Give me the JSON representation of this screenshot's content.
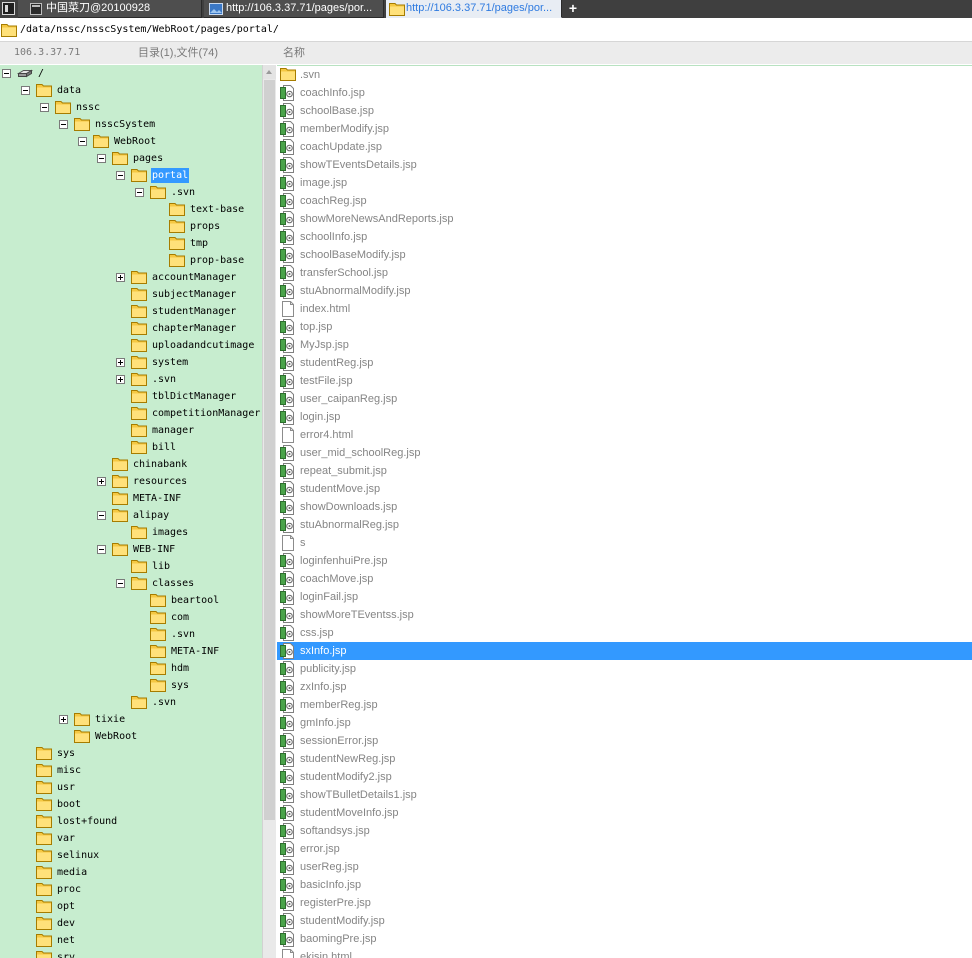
{
  "window": {
    "tabs": [
      {
        "label": "中国菜刀@20100928",
        "icon": "app-window-icon",
        "active": false
      },
      {
        "label": "http://106.3.37.71/pages/por...",
        "icon": "image-icon",
        "active": false
      },
      {
        "label": "http://106.3.37.71/pages/por...",
        "icon": "folder-icon",
        "active": true
      }
    ],
    "new_tab_label": "+"
  },
  "address_bar": {
    "icon": "folder-icon",
    "path": "/data/nssc/nsscSystem/WebRoot/pages/portal/"
  },
  "header": {
    "host": "106.3.37.71",
    "summary": "目录(1),文件(74)",
    "name_column": "名称"
  },
  "tree": {
    "items": [
      {
        "label": "/",
        "level": 0,
        "icon": "drive-icon",
        "expanded": true
      },
      {
        "label": "data",
        "level": 1,
        "icon": "folder-icon",
        "expanded": true
      },
      {
        "label": "nssc",
        "level": 2,
        "icon": "folder-icon",
        "expanded": true
      },
      {
        "label": "nsscSystem",
        "level": 3,
        "icon": "folder-icon",
        "expanded": true
      },
      {
        "label": "WebRoot",
        "level": 4,
        "icon": "folder-icon",
        "expanded": true
      },
      {
        "label": "pages",
        "level": 5,
        "icon": "folder-icon",
        "expanded": true
      },
      {
        "label": "portal",
        "level": 6,
        "icon": "folder-icon",
        "expanded": true,
        "selected": true
      },
      {
        "label": ".svn",
        "level": 7,
        "icon": "folder-icon",
        "expanded": true
      },
      {
        "label": "text-base",
        "level": 8,
        "icon": "folder-icon"
      },
      {
        "label": "props",
        "level": 8,
        "icon": "folder-icon"
      },
      {
        "label": "tmp",
        "level": 8,
        "icon": "folder-icon"
      },
      {
        "label": "prop-base",
        "level": 8,
        "icon": "folder-icon"
      },
      {
        "label": "accountManager",
        "level": 6,
        "icon": "folder-icon",
        "expanded": false
      },
      {
        "label": "subjectManager",
        "level": 6,
        "icon": "folder-icon"
      },
      {
        "label": "studentManager",
        "level": 6,
        "icon": "folder-icon"
      },
      {
        "label": "chapterManager",
        "level": 6,
        "icon": "folder-icon"
      },
      {
        "label": "uploadandcutimage",
        "level": 6,
        "icon": "folder-icon"
      },
      {
        "label": "system",
        "level": 6,
        "icon": "folder-icon",
        "expanded": false
      },
      {
        "label": ".svn",
        "level": 6,
        "icon": "folder-icon",
        "expanded": false
      },
      {
        "label": "tblDictManager",
        "level": 6,
        "icon": "folder-icon"
      },
      {
        "label": "competitionManager",
        "level": 6,
        "icon": "folder-icon"
      },
      {
        "label": "manager",
        "level": 6,
        "icon": "folder-icon"
      },
      {
        "label": "bill",
        "level": 6,
        "icon": "folder-icon"
      },
      {
        "label": "chinabank",
        "level": 5,
        "icon": "folder-icon"
      },
      {
        "label": "resources",
        "level": 5,
        "icon": "folder-icon",
        "expanded": false
      },
      {
        "label": "META-INF",
        "level": 5,
        "icon": "folder-icon"
      },
      {
        "label": "alipay",
        "level": 5,
        "icon": "folder-icon",
        "expanded": true
      },
      {
        "label": "images",
        "level": 6,
        "icon": "folder-icon"
      },
      {
        "label": "WEB-INF",
        "level": 5,
        "icon": "folder-icon",
        "expanded": true
      },
      {
        "label": "lib",
        "level": 6,
        "icon": "folder-icon"
      },
      {
        "label": "classes",
        "level": 6,
        "icon": "folder-icon",
        "expanded": true
      },
      {
        "label": "beartool",
        "level": 7,
        "icon": "folder-icon"
      },
      {
        "label": "com",
        "level": 7,
        "icon": "folder-icon"
      },
      {
        "label": ".svn",
        "level": 7,
        "icon": "folder-icon"
      },
      {
        "label": "META-INF",
        "level": 7,
        "icon": "folder-icon"
      },
      {
        "label": "hdm",
        "level": 7,
        "icon": "folder-icon"
      },
      {
        "label": "sys",
        "level": 7,
        "icon": "folder-icon"
      },
      {
        "label": ".svn",
        "level": 6,
        "icon": "folder-icon"
      },
      {
        "label": "tixie",
        "level": 3,
        "icon": "folder-icon",
        "expanded": false
      },
      {
        "label": "WebRoot",
        "level": 3,
        "icon": "folder-icon"
      },
      {
        "label": "sys",
        "level": 1,
        "icon": "folder-icon"
      },
      {
        "label": "misc",
        "level": 1,
        "icon": "folder-icon"
      },
      {
        "label": "usr",
        "level": 1,
        "icon": "folder-icon"
      },
      {
        "label": "boot",
        "level": 1,
        "icon": "folder-icon"
      },
      {
        "label": "lost+found",
        "level": 1,
        "icon": "folder-icon"
      },
      {
        "label": "var",
        "level": 1,
        "icon": "folder-icon"
      },
      {
        "label": "selinux",
        "level": 1,
        "icon": "folder-icon"
      },
      {
        "label": "media",
        "level": 1,
        "icon": "folder-icon"
      },
      {
        "label": "proc",
        "level": 1,
        "icon": "folder-icon"
      },
      {
        "label": "opt",
        "level": 1,
        "icon": "folder-icon"
      },
      {
        "label": "dev",
        "level": 1,
        "icon": "folder-icon"
      },
      {
        "label": "net",
        "level": 1,
        "icon": "folder-icon"
      },
      {
        "label": "srv",
        "level": 1,
        "icon": "folder-icon"
      }
    ]
  },
  "files": {
    "items": [
      {
        "name": ".svn",
        "icon": "folder-icon"
      },
      {
        "name": "coachInfo.jsp",
        "icon": "jsp-file-icon"
      },
      {
        "name": "schoolBase.jsp",
        "icon": "jsp-file-icon"
      },
      {
        "name": "memberModify.jsp",
        "icon": "jsp-file-icon"
      },
      {
        "name": "coachUpdate.jsp",
        "icon": "jsp-file-icon"
      },
      {
        "name": "showTEventsDetails.jsp",
        "icon": "jsp-file-icon"
      },
      {
        "name": "image.jsp",
        "icon": "jsp-file-icon"
      },
      {
        "name": "coachReg.jsp",
        "icon": "jsp-file-icon"
      },
      {
        "name": "showMoreNewsAndReports.jsp",
        "icon": "jsp-file-icon"
      },
      {
        "name": "schoolInfo.jsp",
        "icon": "jsp-file-icon"
      },
      {
        "name": "schoolBaseModify.jsp",
        "icon": "jsp-file-icon"
      },
      {
        "name": "transferSchool.jsp",
        "icon": "jsp-file-icon"
      },
      {
        "name": "stuAbnormalModify.jsp",
        "icon": "jsp-file-icon"
      },
      {
        "name": "index.html",
        "icon": "html-file-icon"
      },
      {
        "name": "top.jsp",
        "icon": "jsp-file-icon"
      },
      {
        "name": "MyJsp.jsp",
        "icon": "jsp-file-icon"
      },
      {
        "name": "studentReg.jsp",
        "icon": "jsp-file-icon"
      },
      {
        "name": "testFile.jsp",
        "icon": "jsp-file-icon"
      },
      {
        "name": "user_caipanReg.jsp",
        "icon": "jsp-file-icon"
      },
      {
        "name": "login.jsp",
        "icon": "jsp-file-icon"
      },
      {
        "name": "error4.html",
        "icon": "html-file-icon"
      },
      {
        "name": "user_mid_schoolReg.jsp",
        "icon": "jsp-file-icon"
      },
      {
        "name": "repeat_submit.jsp",
        "icon": "jsp-file-icon"
      },
      {
        "name": "studentMove.jsp",
        "icon": "jsp-file-icon"
      },
      {
        "name": "showDownloads.jsp",
        "icon": "jsp-file-icon"
      },
      {
        "name": "stuAbnormalReg.jsp",
        "icon": "jsp-file-icon"
      },
      {
        "name": "s",
        "icon": "file-icon"
      },
      {
        "name": "loginfenhuiPre.jsp",
        "icon": "jsp-file-icon"
      },
      {
        "name": "coachMove.jsp",
        "icon": "jsp-file-icon"
      },
      {
        "name": "loginFail.jsp",
        "icon": "jsp-file-icon"
      },
      {
        "name": "showMoreTEventss.jsp",
        "icon": "jsp-file-icon"
      },
      {
        "name": "css.jsp",
        "icon": "jsp-file-icon"
      },
      {
        "name": "sxInfo.jsp",
        "icon": "jsp-file-icon",
        "selected": true
      },
      {
        "name": "publicity.jsp",
        "icon": "jsp-file-icon"
      },
      {
        "name": "zxInfo.jsp",
        "icon": "jsp-file-icon"
      },
      {
        "name": "memberReg.jsp",
        "icon": "jsp-file-icon"
      },
      {
        "name": "gmInfo.jsp",
        "icon": "jsp-file-icon"
      },
      {
        "name": "sessionError.jsp",
        "icon": "jsp-file-icon"
      },
      {
        "name": "studentNewReg.jsp",
        "icon": "jsp-file-icon"
      },
      {
        "name": "studentModify2.jsp",
        "icon": "jsp-file-icon"
      },
      {
        "name": "showTBulletDetails1.jsp",
        "icon": "jsp-file-icon"
      },
      {
        "name": "studentMoveInfo.jsp",
        "icon": "jsp-file-icon"
      },
      {
        "name": "softandsys.jsp",
        "icon": "jsp-file-icon"
      },
      {
        "name": "error.jsp",
        "icon": "jsp-file-icon"
      },
      {
        "name": "userReg.jsp",
        "icon": "jsp-file-icon"
      },
      {
        "name": "basicInfo.jsp",
        "icon": "jsp-file-icon"
      },
      {
        "name": "registerPre.jsp",
        "icon": "jsp-file-icon"
      },
      {
        "name": "studentModify.jsp",
        "icon": "jsp-file-icon"
      },
      {
        "name": "baomingPre.jsp",
        "icon": "jsp-file-icon"
      },
      {
        "name": "ekisin.html",
        "icon": "html-file-icon"
      }
    ]
  },
  "colors": {
    "tab_bar": "#3f3f3f",
    "tab": "#4e4e4e",
    "active_tab": "#e8edf4",
    "active_tab_text": "#2f7be0",
    "header_background": "#ececec",
    "tree_background": "#c7edcf",
    "selection": "#3399ff",
    "file_text": "#858585"
  }
}
